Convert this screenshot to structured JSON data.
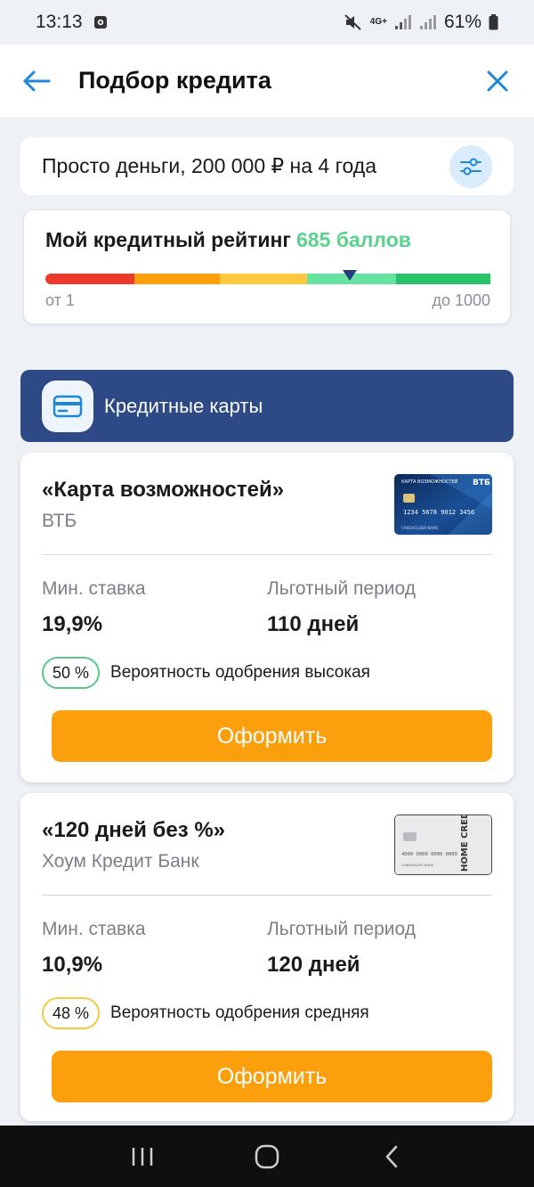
{
  "status_bar": {
    "time": "13:13",
    "network": "4G+",
    "battery": "61%"
  },
  "header": {
    "title": "Подбор кредита"
  },
  "filter": {
    "summary": "Просто деньги, 200 000 ₽ на 4 года"
  },
  "rating": {
    "title": "Мой кредитный рейтинг",
    "score_label": "685 баллов",
    "score": 685,
    "min_label": "от 1",
    "max_label": "до 1000",
    "min": 1,
    "max": 1000,
    "segment_colors": [
      "#ee3a2c",
      "#fb9f0c",
      "#fdc93c",
      "#66e3a0",
      "#27c46a"
    ]
  },
  "category": {
    "label": "Кредитные карты"
  },
  "offers": [
    {
      "name": "«Карта возможностей»",
      "bank": "ВТБ",
      "rate_label": "Мин. ставка",
      "rate": "19,9%",
      "grace_label": "Льготный период",
      "grace": "110 дней",
      "approval_percent": "50 %",
      "approval_text": "Вероятность одобрения высокая",
      "button_label": "Оформить",
      "card_image": {
        "brand": "ВТБ",
        "title": "КАРТА ВОЗМОЖНОСТЕЙ",
        "number": "1234 5678 9012 3456",
        "holder": "CARDHOLDER NAME"
      }
    },
    {
      "name": "«120 дней без %»",
      "bank": "Хоум Кредит Банк",
      "rate_label": "Мин. ставка",
      "rate": "10,9%",
      "grace_label": "Льготный период",
      "grace": "120 дней",
      "approval_percent": "48 %",
      "approval_text": "Вероятность одобрения средняя",
      "button_label": "Оформить",
      "card_image": {
        "brand": "HOME CREDIT BANK",
        "number": "4000 0000 0000 0000",
        "holder": "CARDHOLDER NAME"
      }
    }
  ],
  "colors": {
    "accent_blue": "#1e88d6",
    "category_bg": "#2d4a86",
    "score_green": "#58d38c",
    "button_orange": "#fb9f0c",
    "badge_high": "#58c987",
    "badge_mid": "#f4c842"
  }
}
